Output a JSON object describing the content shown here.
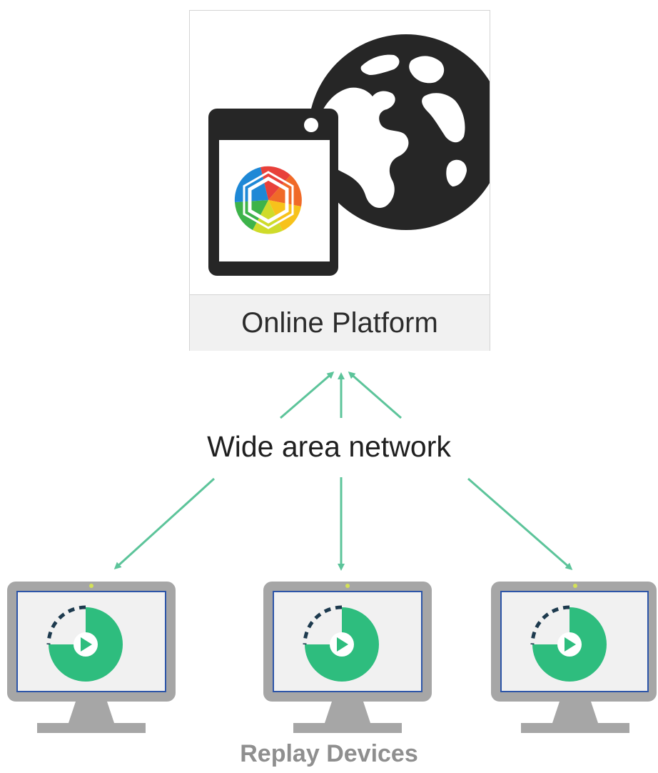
{
  "platform": {
    "label": "Online Platform",
    "tablet_icon": "tablet-icon",
    "globe_icon": "globe-icon",
    "logo_icon": "hexagon-color-wheel-logo"
  },
  "network": {
    "label": "Wide area network"
  },
  "devices": {
    "caption": "Replay Devices",
    "count": 3,
    "monitor_icon": "desktop-monitor-icon",
    "screen_icon": "replay-play-icon"
  },
  "colors": {
    "arrow": "#5cc49a",
    "replay_green": "#2ebd7e",
    "dash_navy": "#1d3a4e",
    "monitor_gray": "#a6a6a6",
    "screen_border": "#2d55a8"
  }
}
